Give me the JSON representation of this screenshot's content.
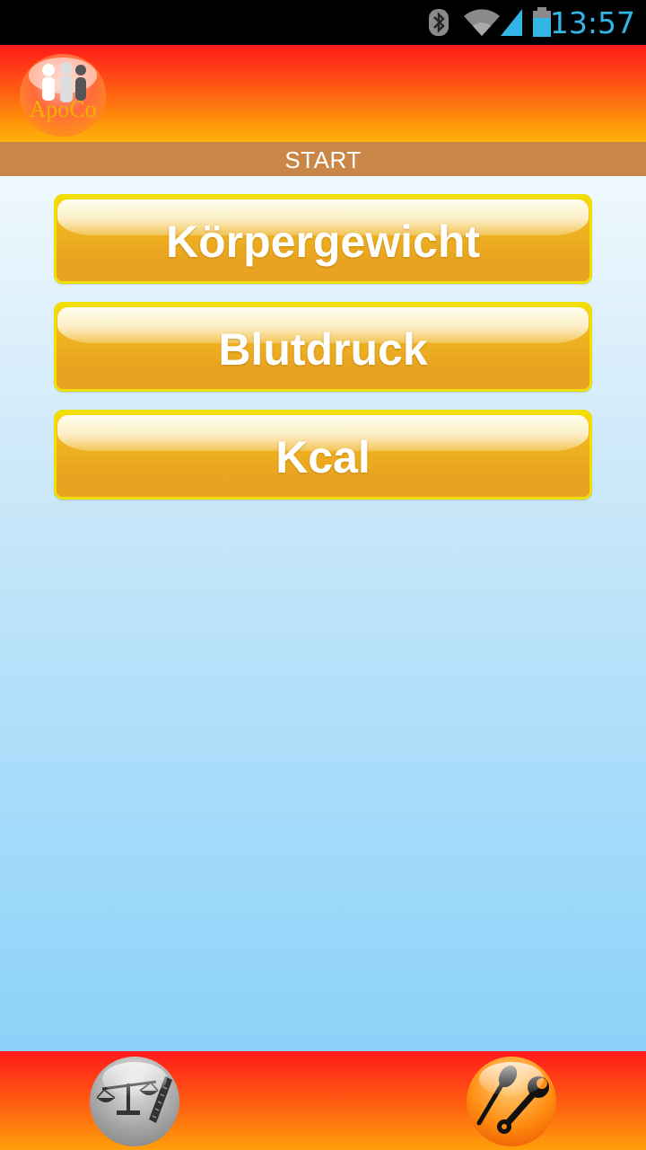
{
  "status_bar": {
    "time": "13:57",
    "icons": [
      "bluetooth-icon",
      "wifi-icon",
      "signal-icon",
      "battery-icon"
    ],
    "accent_color": "#33b5e5"
  },
  "header": {
    "logo_text": "ApoCo",
    "colors": {
      "top": "#ff1a1a",
      "bottom": "#ffb00a"
    }
  },
  "title_bar": {
    "title": "START",
    "color": "#c98647"
  },
  "menu": {
    "items": [
      {
        "label": "Körpergewicht"
      },
      {
        "label": "Blutdruck"
      },
      {
        "label": "Kcal"
      }
    ],
    "button_color": "#e9a520"
  },
  "footer": {
    "buttons": [
      {
        "icon": "scale-ruler-icon"
      },
      {
        "icon": "tools-icon"
      }
    ]
  }
}
